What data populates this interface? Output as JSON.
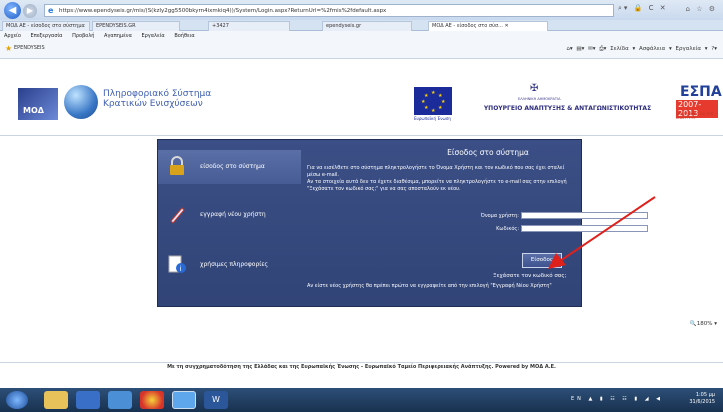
{
  "browser": {
    "url": "https://www.ependyseis.gr/mis/(S(kzIy2gg5500bkyrn4ixmkiq4))/System/Login.aspx?ReturnUrl=%2fmis%2fdefault.aspx",
    "tabs": [
      {
        "label": "ΜΟΔ ΑΕ - είσοδος στο σύστημα"
      },
      {
        "label": "EPENDYSEIS.GR"
      },
      {
        "label": "+3427"
      },
      {
        "label": "ependyseis.gr"
      },
      {
        "label": "ΜΟΔ ΑΕ - είσοδος στο σύσ..."
      }
    ],
    "menu": [
      "Αρχείο",
      "Επεξεργασία",
      "Προβολή",
      "Αγαπημένα",
      "Εργαλεία",
      "Βοήθεια"
    ],
    "favorite": "EPENDYSEIS",
    "cmd_tools": [
      "Σελίδα ▾",
      "Ασφάλεια ▾",
      "Εργαλεία ▾"
    ],
    "zoom": "180%"
  },
  "header": {
    "logo_text": "ΜΟΔ",
    "system_name_line1": "Πληροφοριακό Σύστημα",
    "system_name_line2": "Κρατικών Ενισχύσεων",
    "eu_caption": "Ευρωπαϊκή Ένωση",
    "ministry_sub": "ΕΛΛΗΝΙΚΗ ΔΗΜΟΚΡΑΤΙΑ",
    "ministry": "ΥΠΟΥΡΓΕΙΟ ΑΝΑΠΤΥΞΗΣ & ΑΝΤΑΓΩΝΙΣΤΙΚΟΤΗΤΑΣ",
    "espa_title": "ΕΣΠΑ",
    "espa_years": "2007-2013",
    "espa_sub": "ΠΡΟΓΡΑΜΜΑ ΓΙΑ ΤΗΝ ΑΝΑΠΤΥΞΗ"
  },
  "sidebar": {
    "items": [
      {
        "label": "είσοδος στο σύστημα",
        "icon": "lock-icon"
      },
      {
        "label": "εγγραφή νέου χρήστη",
        "icon": "pen-icon"
      },
      {
        "label": "χρήσιμες πληροφορίες",
        "icon": "info-icon"
      }
    ]
  },
  "login": {
    "title": "Είσοδος στο σύστημα",
    "desc1": "Για να εισέλθετε στο σύστημα πληκτρολογήστε το Όνομα Χρήστη και τον κωδικό που σας έχει σταλεί μέσω e-mail.",
    "desc2": "Αν τα στοιχεία αυτά δεν τα έχετε διαθέσιμα, μπορείτε να πληκτρολογήστε το e-mail σας στην επιλογή \"Ξεχάσατε τον κωδικό σας;\" για να σας αποσταλούν εκ νέου.",
    "username_label": "Όνομα χρήστη:",
    "password_label": "Κωδικός:",
    "button": "Είσοδος",
    "forgot": "Ξεχάσατε τον κωδικό σας;",
    "register_note": "Αν είστε νέος χρήστης θα πρέπει πρώτα να εγγραφείτε από την επιλογή \"Εγγραφή Νέου Χρήστη\""
  },
  "footer": {
    "text": "Με τη συγχρηματοδότηση της Ελλάδας και της Ευρωπαϊκής Ένωσης - Ευρωπαϊκό Ταμείο Περιφερειακής Ανάπτυξης.  Powered by ΜΟΔ Α.Ε."
  },
  "taskbar": {
    "lang": "EN",
    "time": "1:05 μμ",
    "date": "31/6/2015"
  },
  "colors": {
    "panel": "#3b4f86",
    "arrow": "#e0201b",
    "taskbar": "#1f3a5c"
  }
}
